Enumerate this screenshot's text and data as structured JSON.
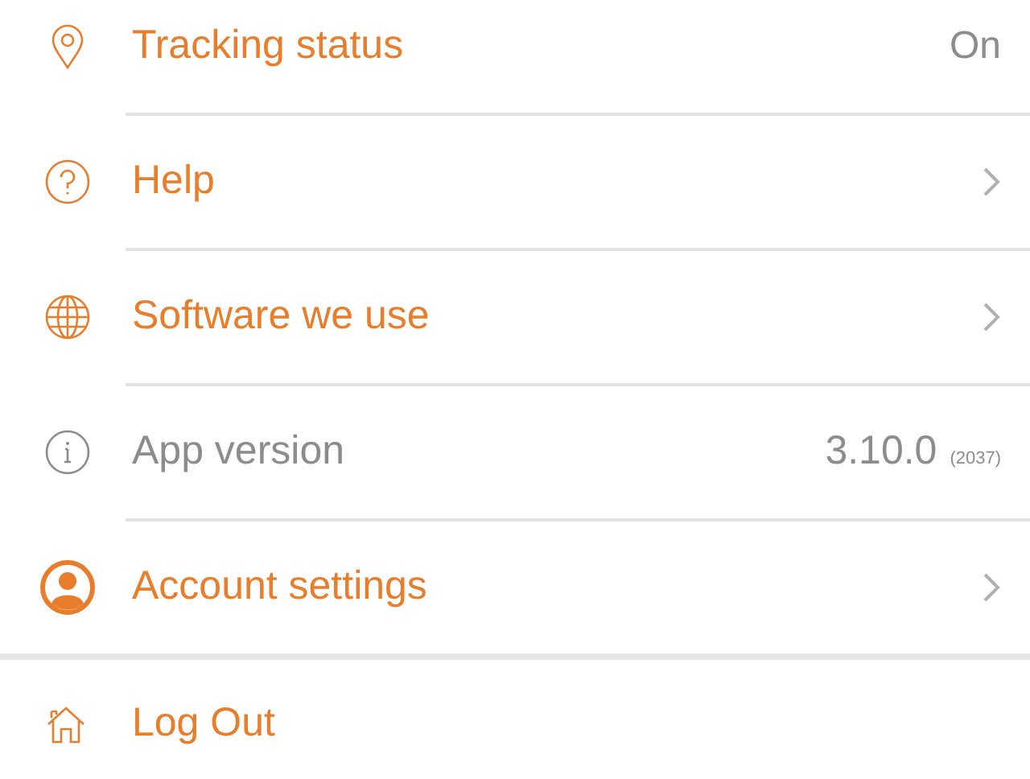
{
  "menu": [
    {
      "kind": "value",
      "label": "Tracking status",
      "value": "On"
    },
    {
      "kind": "link",
      "label": "Help"
    },
    {
      "kind": "link",
      "label": "Software we use"
    },
    {
      "kind": "info",
      "label": "App version",
      "value": "3.10.0",
      "build": "(2037)"
    },
    {
      "kind": "link",
      "label": "Account settings"
    }
  ],
  "logout": {
    "label": "Log Out"
  }
}
